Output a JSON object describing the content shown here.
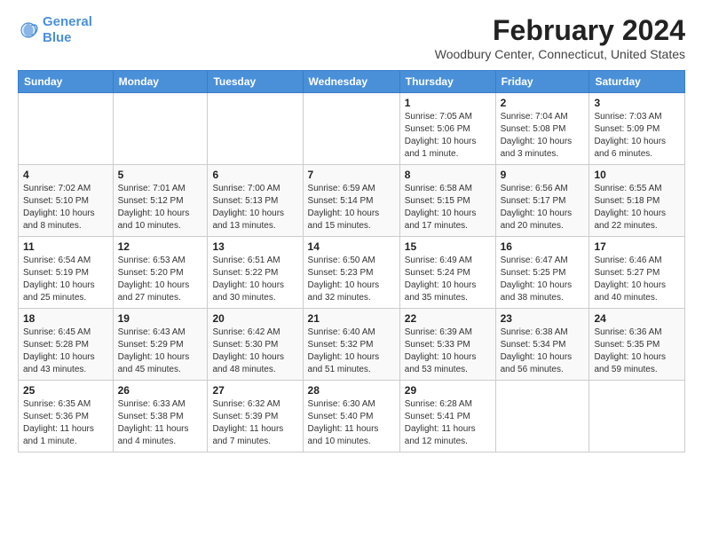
{
  "logo": {
    "line1": "General",
    "line2": "Blue"
  },
  "title": "February 2024",
  "subtitle": "Woodbury Center, Connecticut, United States",
  "days_of_week": [
    "Sunday",
    "Monday",
    "Tuesday",
    "Wednesday",
    "Thursday",
    "Friday",
    "Saturday"
  ],
  "weeks": [
    [
      {
        "day": "",
        "info": ""
      },
      {
        "day": "",
        "info": ""
      },
      {
        "day": "",
        "info": ""
      },
      {
        "day": "",
        "info": ""
      },
      {
        "day": "1",
        "info": "Sunrise: 7:05 AM\nSunset: 5:06 PM\nDaylight: 10 hours\nand 1 minute."
      },
      {
        "day": "2",
        "info": "Sunrise: 7:04 AM\nSunset: 5:08 PM\nDaylight: 10 hours\nand 3 minutes."
      },
      {
        "day": "3",
        "info": "Sunrise: 7:03 AM\nSunset: 5:09 PM\nDaylight: 10 hours\nand 6 minutes."
      }
    ],
    [
      {
        "day": "4",
        "info": "Sunrise: 7:02 AM\nSunset: 5:10 PM\nDaylight: 10 hours\nand 8 minutes."
      },
      {
        "day": "5",
        "info": "Sunrise: 7:01 AM\nSunset: 5:12 PM\nDaylight: 10 hours\nand 10 minutes."
      },
      {
        "day": "6",
        "info": "Sunrise: 7:00 AM\nSunset: 5:13 PM\nDaylight: 10 hours\nand 13 minutes."
      },
      {
        "day": "7",
        "info": "Sunrise: 6:59 AM\nSunset: 5:14 PM\nDaylight: 10 hours\nand 15 minutes."
      },
      {
        "day": "8",
        "info": "Sunrise: 6:58 AM\nSunset: 5:15 PM\nDaylight: 10 hours\nand 17 minutes."
      },
      {
        "day": "9",
        "info": "Sunrise: 6:56 AM\nSunset: 5:17 PM\nDaylight: 10 hours\nand 20 minutes."
      },
      {
        "day": "10",
        "info": "Sunrise: 6:55 AM\nSunset: 5:18 PM\nDaylight: 10 hours\nand 22 minutes."
      }
    ],
    [
      {
        "day": "11",
        "info": "Sunrise: 6:54 AM\nSunset: 5:19 PM\nDaylight: 10 hours\nand 25 minutes."
      },
      {
        "day": "12",
        "info": "Sunrise: 6:53 AM\nSunset: 5:20 PM\nDaylight: 10 hours\nand 27 minutes."
      },
      {
        "day": "13",
        "info": "Sunrise: 6:51 AM\nSunset: 5:22 PM\nDaylight: 10 hours\nand 30 minutes."
      },
      {
        "day": "14",
        "info": "Sunrise: 6:50 AM\nSunset: 5:23 PM\nDaylight: 10 hours\nand 32 minutes."
      },
      {
        "day": "15",
        "info": "Sunrise: 6:49 AM\nSunset: 5:24 PM\nDaylight: 10 hours\nand 35 minutes."
      },
      {
        "day": "16",
        "info": "Sunrise: 6:47 AM\nSunset: 5:25 PM\nDaylight: 10 hours\nand 38 minutes."
      },
      {
        "day": "17",
        "info": "Sunrise: 6:46 AM\nSunset: 5:27 PM\nDaylight: 10 hours\nand 40 minutes."
      }
    ],
    [
      {
        "day": "18",
        "info": "Sunrise: 6:45 AM\nSunset: 5:28 PM\nDaylight: 10 hours\nand 43 minutes."
      },
      {
        "day": "19",
        "info": "Sunrise: 6:43 AM\nSunset: 5:29 PM\nDaylight: 10 hours\nand 45 minutes."
      },
      {
        "day": "20",
        "info": "Sunrise: 6:42 AM\nSunset: 5:30 PM\nDaylight: 10 hours\nand 48 minutes."
      },
      {
        "day": "21",
        "info": "Sunrise: 6:40 AM\nSunset: 5:32 PM\nDaylight: 10 hours\nand 51 minutes."
      },
      {
        "day": "22",
        "info": "Sunrise: 6:39 AM\nSunset: 5:33 PM\nDaylight: 10 hours\nand 53 minutes."
      },
      {
        "day": "23",
        "info": "Sunrise: 6:38 AM\nSunset: 5:34 PM\nDaylight: 10 hours\nand 56 minutes."
      },
      {
        "day": "24",
        "info": "Sunrise: 6:36 AM\nSunset: 5:35 PM\nDaylight: 10 hours\nand 59 minutes."
      }
    ],
    [
      {
        "day": "25",
        "info": "Sunrise: 6:35 AM\nSunset: 5:36 PM\nDaylight: 11 hours\nand 1 minute."
      },
      {
        "day": "26",
        "info": "Sunrise: 6:33 AM\nSunset: 5:38 PM\nDaylight: 11 hours\nand 4 minutes."
      },
      {
        "day": "27",
        "info": "Sunrise: 6:32 AM\nSunset: 5:39 PM\nDaylight: 11 hours\nand 7 minutes."
      },
      {
        "day": "28",
        "info": "Sunrise: 6:30 AM\nSunset: 5:40 PM\nDaylight: 11 hours\nand 10 minutes."
      },
      {
        "day": "29",
        "info": "Sunrise: 6:28 AM\nSunset: 5:41 PM\nDaylight: 11 hours\nand 12 minutes."
      },
      {
        "day": "",
        "info": ""
      },
      {
        "day": "",
        "info": ""
      }
    ]
  ]
}
